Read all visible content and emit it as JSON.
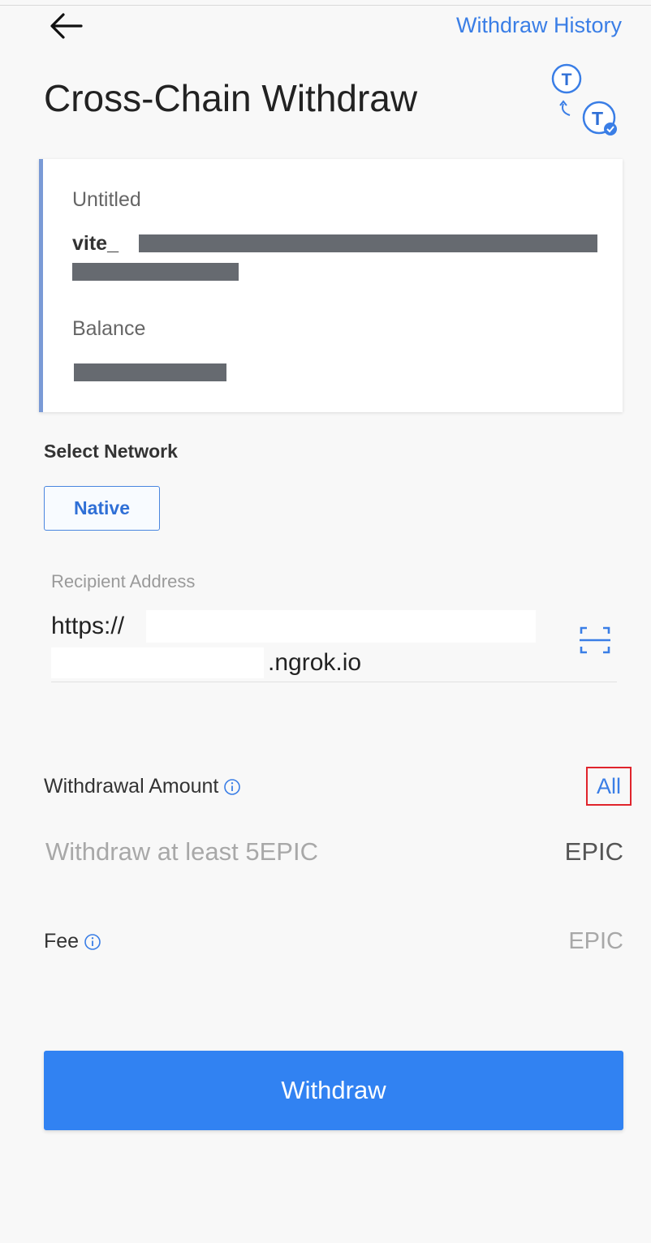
{
  "header": {
    "history_link": "Withdraw History",
    "title": "Cross-Chain Withdraw",
    "logo": {
      "letter_top": "T",
      "letter_bottom": "T",
      "icon": "token-swap-icon"
    }
  },
  "account_card": {
    "name": "Untitled",
    "address_prefix": "vite_",
    "balance_label": "Balance"
  },
  "network": {
    "label": "Select Network",
    "selected": "Native"
  },
  "recipient": {
    "label": "Recipient Address",
    "value_line1": "https://",
    "value_line2": ".ngrok.io",
    "scan_icon": "scan-icon"
  },
  "amount": {
    "label": "Withdrawal Amount",
    "all_label": "All",
    "placeholder": "Withdraw at least 5EPIC",
    "unit": "EPIC"
  },
  "fee": {
    "label": "Fee",
    "unit": "EPIC"
  },
  "withdraw_button": "Withdraw",
  "colors": {
    "accent": "#3182f2",
    "link": "#3a7ee6",
    "highlight_box": "#e0242c",
    "card_border": "#7a9ad6"
  }
}
